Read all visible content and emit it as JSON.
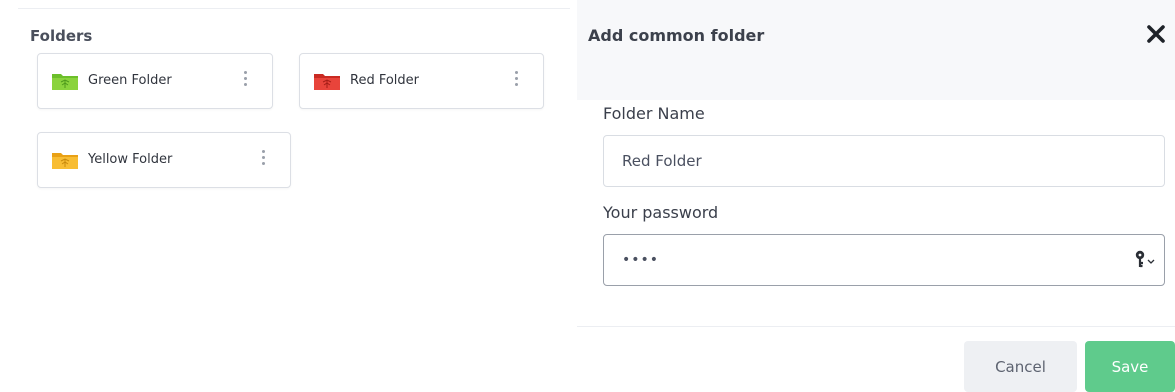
{
  "folders_panel": {
    "title": "Folders",
    "folders": [
      {
        "name": "Green Folder",
        "color": "#6cbf2a",
        "icon": "folder-icon"
      },
      {
        "name": "Red Folder",
        "color": "#e03a32",
        "icon": "folder-icon"
      },
      {
        "name": "Yellow Folder",
        "color": "#f5b324",
        "icon": "folder-icon"
      }
    ],
    "menu_icon": "kebab-menu-icon"
  },
  "dialog": {
    "title": "Add common folder",
    "close_icon": "close-icon",
    "folder_name_label": "Folder Name",
    "folder_name_value": "Red Folder",
    "password_label": "Your password",
    "password_value": "••••",
    "password_manager_icon": "key-icon",
    "cancel_label": "Cancel",
    "save_label": "Save"
  },
  "colors": {
    "save_button": "#5fcb8c",
    "cancel_button": "#eef0f3",
    "header_background": "#f7f8fa"
  }
}
